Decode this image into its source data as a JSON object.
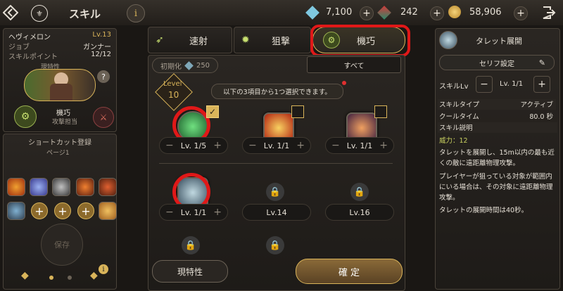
{
  "header": {
    "title": "スキル",
    "crystals": "7,100",
    "red_gems": "242",
    "gold": "58,906"
  },
  "left": {
    "character": "ヘヴィメロン",
    "level": "Lv.13",
    "job_label": "ジョブ",
    "job": "ガンナー",
    "sp_label": "スキルポイント",
    "sp": "12/12",
    "trait_label": "現特性",
    "spec_name": "機巧",
    "spec_role": "攻撃担当",
    "shortcut_title": "ショートカット登録",
    "page_label": "ページ1",
    "save_label": "保存"
  },
  "tabs": {
    "rapid": "速射",
    "snipe": "狙撃",
    "mech": "機巧"
  },
  "center": {
    "reset_label": "初期化",
    "reset_cost": "250",
    "all_label": "すべて",
    "level_word": "Level",
    "level_value": "10",
    "tooltip": "以下の3項目から1つ選択できます。",
    "skills": [
      {
        "level": "Lv. 1/5"
      },
      {
        "level": "Lv. 1/1"
      },
      {
        "level": "Lv. 1/1"
      },
      {
        "level": "Lv. 1/1"
      },
      {
        "level": "Lv.14"
      },
      {
        "level": "Lv.16"
      }
    ],
    "trait_btn": "現特性",
    "confirm_btn": "確 定"
  },
  "right": {
    "skill_name": "タレット展開",
    "dialog_setting": "セリフ設定",
    "skill_lv_label": "スキルLv",
    "skill_lv": "Lv. 1/1",
    "type_label": "スキルタイプ",
    "type_value": "アクティブ",
    "cooldown_label": "クールタイム",
    "cooldown_value": "80.0 秒",
    "desc_label": "スキル説明",
    "power": "威力：12",
    "desc1": "タレットを展開し、15m以内の最も近くの敵に遠距離物理攻撃。",
    "desc2": "プレイヤーが狙っている対象が範囲内にいる場合は、その対象に遠距離物理攻撃。",
    "desc3": "タレットの展開時間は40秒。"
  }
}
